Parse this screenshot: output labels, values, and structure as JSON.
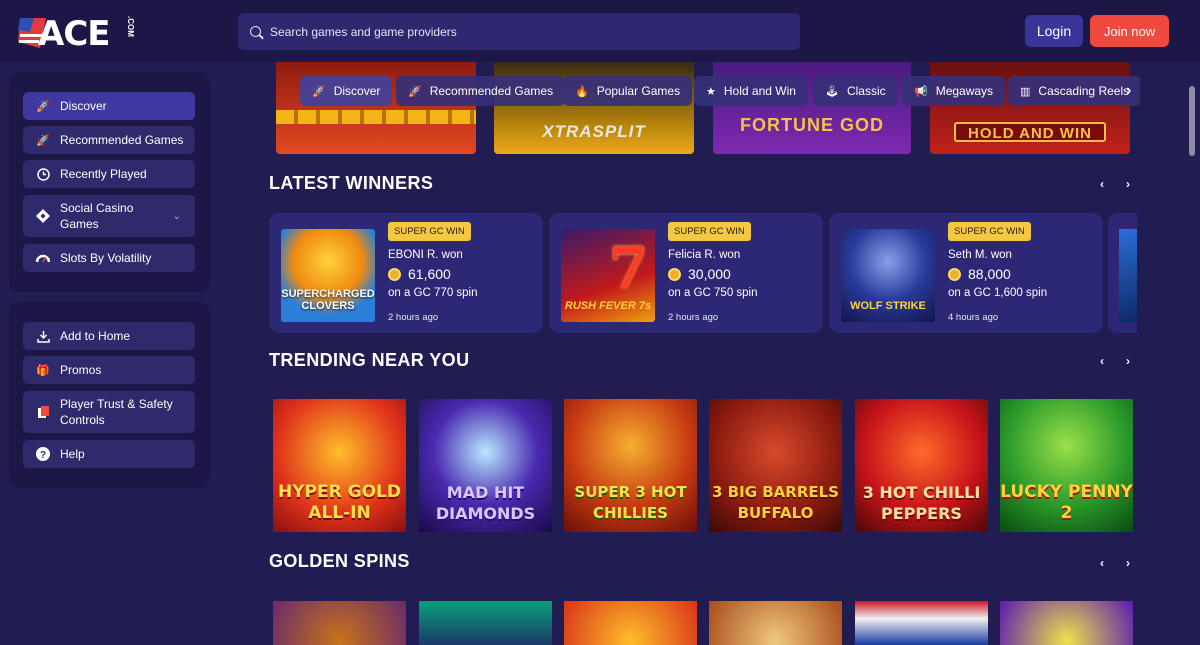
{
  "header": {
    "logo_text": "ACE",
    "logo_suffix": ".COM",
    "search_placeholder": "Search games and game providers",
    "login_label": "Login",
    "join_label": "Join now"
  },
  "sidebar": {
    "primary": [
      {
        "label": "Discover",
        "icon": "rocket-icon",
        "active": true
      },
      {
        "label": "Recommended Games",
        "icon": "rocket-icon"
      },
      {
        "label": "Recently Played",
        "icon": "clock-icon"
      },
      {
        "label": "Social Casino Games",
        "icon": "diamond-icon",
        "expandable": true
      },
      {
        "label": "Slots By Volatility",
        "icon": "gauge-icon"
      }
    ],
    "secondary": [
      {
        "label": "Add to Home",
        "icon": "download-icon"
      },
      {
        "label": "Promos",
        "icon": "gift-icon"
      },
      {
        "label": "Player Trust & Safety Controls",
        "icon": "document-icon"
      },
      {
        "label": "Help",
        "icon": "help-icon"
      }
    ]
  },
  "carousel": {
    "banners": [
      "FORTUNE GOD",
      "HOLD AND WIN"
    ],
    "banner_extra": "XTRASPLIT",
    "chips": [
      {
        "label": "Discover",
        "icon": "rocket-icon",
        "active": true
      },
      {
        "label": "Recommended Games",
        "icon": "rocket-icon"
      },
      {
        "label": "Popular Games",
        "icon": "fire-icon"
      },
      {
        "label": "Hold and Win",
        "icon": "star-icon"
      },
      {
        "label": "Classic",
        "icon": "joystick-icon"
      },
      {
        "label": "Megaways",
        "icon": "megaphone-icon"
      },
      {
        "label": "Cascading Reels",
        "icon": "columns-icon"
      }
    ]
  },
  "latest_winners": {
    "title": "LATEST WINNERS",
    "items": [
      {
        "badge": "SUPER GC WIN",
        "name": "EBONI R. won",
        "amount": "61,600",
        "spin": "on a GC 770 spin",
        "time": "2 hours ago",
        "game": "SUPERCHARGED CLOVERS"
      },
      {
        "badge": "SUPER GC WIN",
        "name": "Felicia R. won",
        "amount": "30,000",
        "spin": "on a GC 750 spin",
        "time": "2 hours ago",
        "game": "RUSH FEVER 7s"
      },
      {
        "badge": "SUPER GC WIN",
        "name": "Seth M. won",
        "amount": "88,000",
        "spin": "on a GC 1,600 spin",
        "time": "4 hours ago",
        "game": "WOLF STRIKE"
      }
    ]
  },
  "trending": {
    "title": "TRENDING NEAR YOU",
    "games": [
      "HYPER GOLD ALL-IN",
      "MAD HIT DIAMONDS",
      "SUPER 3 HOT CHILLIES",
      "3 BIG BARRELS BUFFALO",
      "3 HOT CHILLI PEPPERS",
      "LUCKY PENNY 2"
    ]
  },
  "golden_spins": {
    "title": "GOLDEN SPINS"
  },
  "colors": {
    "background": "#211c52",
    "panel": "#1c1746",
    "accent_join": "#ef4a3d",
    "badge": "#f5c842"
  }
}
